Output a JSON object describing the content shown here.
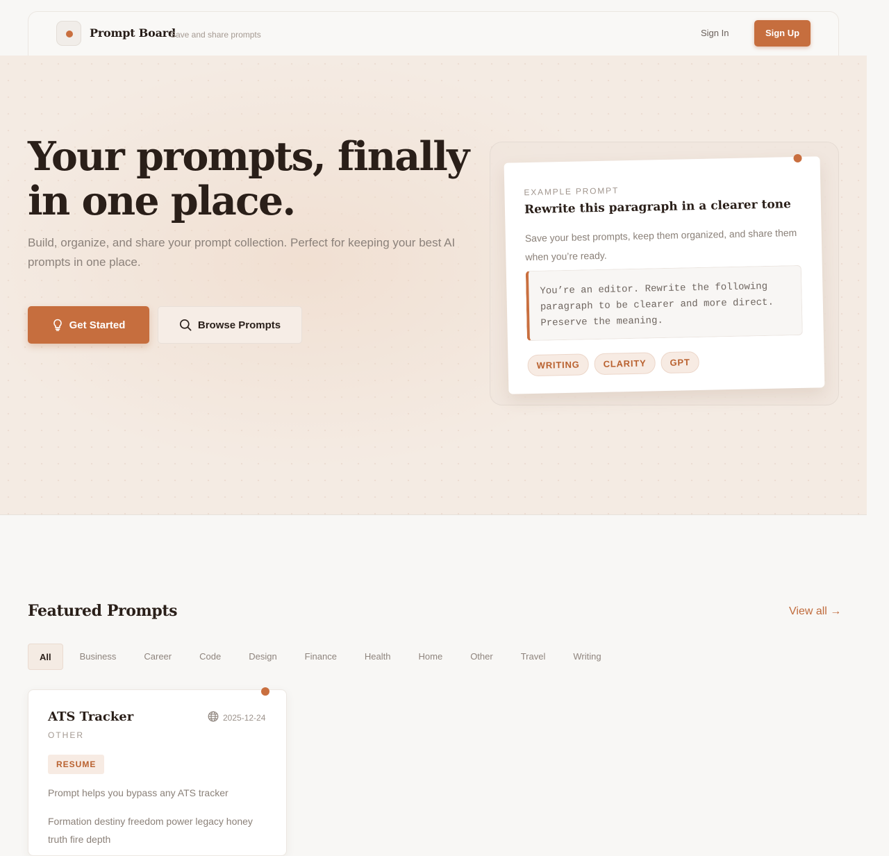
{
  "header": {
    "brand": "Prompt Board",
    "tagline": "Save and share prompts",
    "sign_in": "Sign In",
    "sign_up": "Sign Up"
  },
  "hero": {
    "title": "Your prompts, finally in one place.",
    "lead": "Build, organize, and share your prompt collection. Perfect for keeping your best AI prompts in one place.",
    "primary_button": "Get Started",
    "secondary_button": "Browse Prompts",
    "example": {
      "kicker": "EXAMPLE PROMPT",
      "title": "Rewrite this paragraph in a clearer tone",
      "description": "Save your best prompts, keep them organized, and share them when you’re ready.",
      "prompt_text": "You’re an editor. Rewrite the following paragraph to be clearer and more direct. Preserve the meaning.",
      "tags": [
        "WRITING",
        "CLARITY",
        "GPT"
      ]
    }
  },
  "featured": {
    "title": "Featured Prompts",
    "view_all": "View all →",
    "filters": [
      "All",
      "Business",
      "Career",
      "Code",
      "Design",
      "Finance",
      "Health",
      "Home",
      "Other",
      "Travel",
      "Writing"
    ],
    "active_filter": "All",
    "cards": [
      {
        "title": "ATS Tracker",
        "date": "2025-12-24",
        "visibility_icon": "globe-icon",
        "category": "OTHER",
        "tag": "RESUME",
        "summary": "Prompt helps you bypass any ATS tracker",
        "body": "Formation destiny freedom power legacy honey truth fire depth"
      }
    ]
  },
  "colors": {
    "accent": "#c66e3e",
    "hero_bg": "#f4ebe3",
    "page_bg": "#f8f7f5",
    "heading": "#2a1f19"
  }
}
